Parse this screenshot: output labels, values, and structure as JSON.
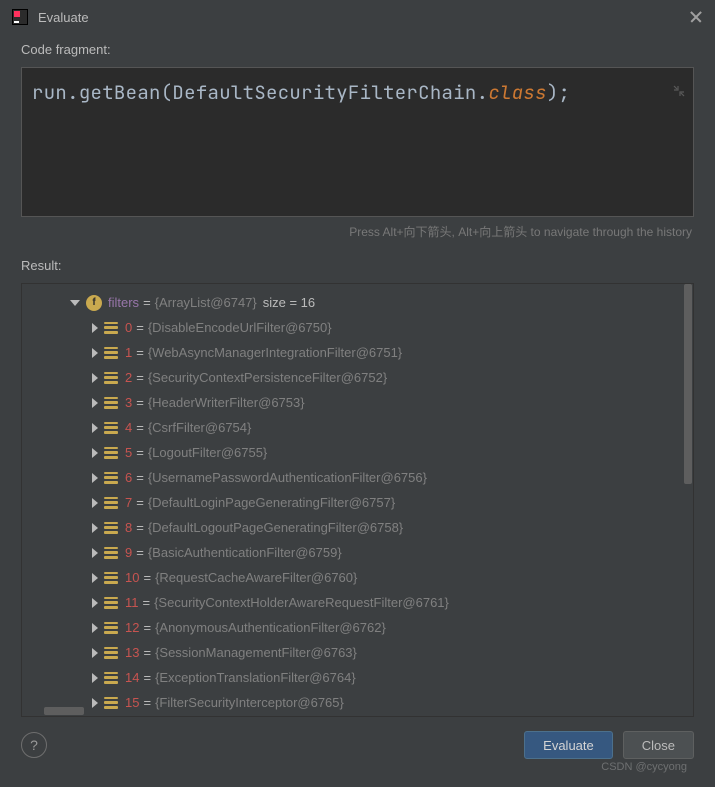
{
  "window": {
    "title": "Evaluate"
  },
  "labels": {
    "codeFragment": "Code fragment:",
    "result": "Result:",
    "hint": "Press Alt+向下箭头, Alt+向上箭头 to navigate through the history"
  },
  "code": {
    "obj": "run",
    "method": "getBean",
    "arg": "DefaultSecurityFilterChain",
    "keyword": "class"
  },
  "result": {
    "parent": {
      "name": "filters",
      "ref": "{ArrayList@6747}",
      "sizeLabel": "size = 16"
    },
    "items": [
      {
        "idx": "0",
        "val": "{DisableEncodeUrlFilter@6750}"
      },
      {
        "idx": "1",
        "val": "{WebAsyncManagerIntegrationFilter@6751}"
      },
      {
        "idx": "2",
        "val": "{SecurityContextPersistenceFilter@6752}"
      },
      {
        "idx": "3",
        "val": "{HeaderWriterFilter@6753}"
      },
      {
        "idx": "4",
        "val": "{CsrfFilter@6754}"
      },
      {
        "idx": "5",
        "val": "{LogoutFilter@6755}"
      },
      {
        "idx": "6",
        "val": "{UsernamePasswordAuthenticationFilter@6756}"
      },
      {
        "idx": "7",
        "val": "{DefaultLoginPageGeneratingFilter@6757}"
      },
      {
        "idx": "8",
        "val": "{DefaultLogoutPageGeneratingFilter@6758}"
      },
      {
        "idx": "9",
        "val": "{BasicAuthenticationFilter@6759}"
      },
      {
        "idx": "10",
        "val": "{RequestCacheAwareFilter@6760}"
      },
      {
        "idx": "11",
        "val": "{SecurityContextHolderAwareRequestFilter@6761}"
      },
      {
        "idx": "12",
        "val": "{AnonymousAuthenticationFilter@6762}"
      },
      {
        "idx": "13",
        "val": "{SessionManagementFilter@6763}"
      },
      {
        "idx": "14",
        "val": "{ExceptionTranslationFilter@6764}"
      },
      {
        "idx": "15",
        "val": "{FilterSecurityInterceptor@6765}"
      }
    ]
  },
  "buttons": {
    "evaluate": "Evaluate",
    "close": "Close",
    "help": "?"
  },
  "watermark": "CSDN @cycyong"
}
